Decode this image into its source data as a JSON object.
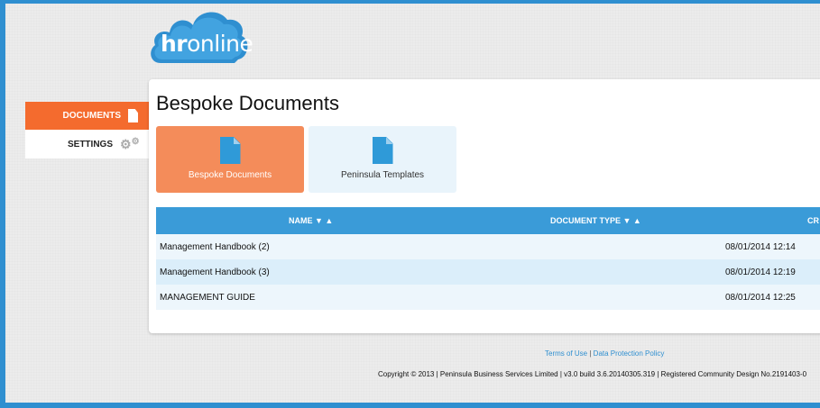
{
  "logo": {
    "part1": "hr",
    "part2": "online"
  },
  "sidebar": {
    "items": [
      {
        "label": "DOCUMENTS",
        "icon": "document-icon",
        "active": true
      },
      {
        "label": "SETTINGS",
        "icon": "gear-icon",
        "active": false
      }
    ]
  },
  "main": {
    "title": "Bespoke Documents",
    "tiles": [
      {
        "label": "Bespoke Documents",
        "icon": "document-icon",
        "active": true
      },
      {
        "label": "Peninsula Templates",
        "icon": "document-icon",
        "active": false
      }
    ],
    "table": {
      "columns": [
        "NAME ▼ ▲",
        "DOCUMENT TYPE ▼ ▲",
        "CR"
      ],
      "rows": [
        {
          "name": "Management Handbook (2)",
          "type": "",
          "created": "08/01/2014 12:14"
        },
        {
          "name": "Management Handbook (3)",
          "type": "",
          "created": "08/01/2014 12:19"
        },
        {
          "name": "MANAGEMENT GUIDE",
          "type": "",
          "created": "08/01/2014 12:25"
        }
      ]
    }
  },
  "footer": {
    "terms": "Terms of Use",
    "separator": "|",
    "privacy": "Data Protection Policy",
    "copyright": "Copyright © 2013 | Peninsula Business Services Limited | v3.0 build 3.6.20140305.319 | Registered Community Design No.2191403-0"
  },
  "colors": {
    "accent": "#f46b2e",
    "tile_active": "#f48c5a",
    "primary_blue": "#3a9bd8",
    "border_blue": "#2f8fd0"
  }
}
